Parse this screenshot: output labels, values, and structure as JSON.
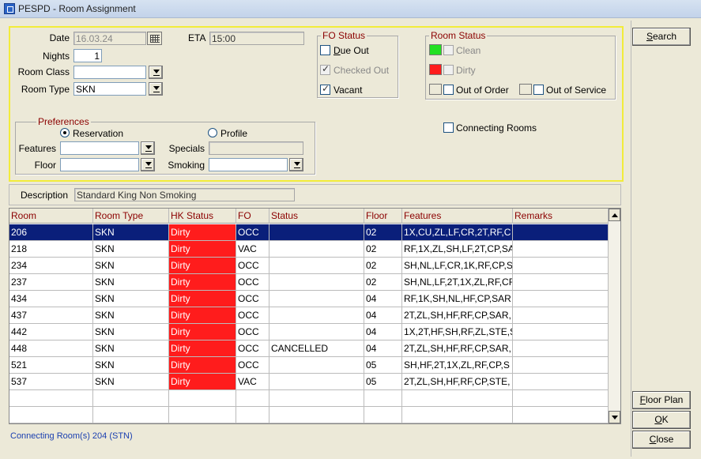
{
  "window": {
    "title": "PESPD - Room Assignment"
  },
  "filters": {
    "date_label": "Date",
    "date_value": "16.03.24",
    "eta_label": "ETA",
    "eta_value": "15:00",
    "nights_label": "Nights",
    "nights_value": "1",
    "room_class_label": "Room Class",
    "room_class_value": "",
    "room_type_label": "Room Type",
    "room_type_value": "SKN"
  },
  "fo_status": {
    "title": "FO Status",
    "due_out": {
      "label": "Due Out",
      "checked": false
    },
    "checked_out": {
      "label": "Checked Out",
      "checked": true
    },
    "vacant": {
      "label": "Vacant",
      "checked": true
    }
  },
  "room_status": {
    "title": "Room Status",
    "clean": {
      "label": "Clean",
      "color": "#22e022"
    },
    "dirty": {
      "label": "Dirty",
      "color": "#ff1c1c"
    },
    "out_of_order": {
      "label": "Out of Order"
    },
    "out_of_service": {
      "label": "Out of Service"
    }
  },
  "connecting_rooms": {
    "label": "Connecting Rooms"
  },
  "preferences": {
    "title": "Preferences",
    "reservation_label": "Reservation",
    "profile_label": "Profile",
    "features_label": "Features",
    "features_value": "",
    "specials_label": "Specials",
    "specials_value": "",
    "floor_label": "Floor",
    "floor_value": "",
    "smoking_label": "Smoking",
    "smoking_value": ""
  },
  "description": {
    "label": "Description",
    "value": "Standard King Non Smoking"
  },
  "table": {
    "columns": [
      "Room",
      "Room Type",
      "HK Status",
      "FO",
      "Status",
      "Floor",
      "Features",
      "Remarks"
    ],
    "rows": [
      {
        "room": "206",
        "type": "SKN",
        "hk": "Dirty",
        "fo": "OCC",
        "status": "",
        "floor": "02",
        "features": "1X,CU,ZL,LF,CR,2T,RF,C",
        "remarks": ""
      },
      {
        "room": "218",
        "type": "SKN",
        "hk": "Dirty",
        "fo": "VAC",
        "status": "",
        "floor": "02",
        "features": "RF,1X,ZL,SH,LF,2T,CP,SA",
        "remarks": ""
      },
      {
        "room": "234",
        "type": "SKN",
        "hk": "Dirty",
        "fo": "OCC",
        "status": "",
        "floor": "02",
        "features": "SH,NL,LF,CR,1K,RF,CP,S",
        "remarks": ""
      },
      {
        "room": "237",
        "type": "SKN",
        "hk": "Dirty",
        "fo": "OCC",
        "status": "",
        "floor": "02",
        "features": "SH,NL,LF,2T,1X,ZL,RF,CF",
        "remarks": ""
      },
      {
        "room": "434",
        "type": "SKN",
        "hk": "Dirty",
        "fo": "OCC",
        "status": "",
        "floor": "04",
        "features": "RF,1K,SH,NL,HF,CP,SAR",
        "remarks": ""
      },
      {
        "room": "437",
        "type": "SKN",
        "hk": "Dirty",
        "fo": "OCC",
        "status": "",
        "floor": "04",
        "features": "2T,ZL,SH,HF,RF,CP,SAR,",
        "remarks": ""
      },
      {
        "room": "442",
        "type": "SKN",
        "hk": "Dirty",
        "fo": "OCC",
        "status": "",
        "floor": "04",
        "features": "1X,2T,HF,SH,RF,ZL,STE,S",
        "remarks": ""
      },
      {
        "room": "448",
        "type": "SKN",
        "hk": "Dirty",
        "fo": "OCC",
        "status": "CANCELLED",
        "floor": "04",
        "features": "2T,ZL,SH,HF,RF,CP,SAR,",
        "remarks": ""
      },
      {
        "room": "521",
        "type": "SKN",
        "hk": "Dirty",
        "fo": "OCC",
        "status": "",
        "floor": "05",
        "features": "SH,HF,2T,1X,ZL,RF,CP,S",
        "remarks": ""
      },
      {
        "room": "537",
        "type": "SKN",
        "hk": "Dirty",
        "fo": "VAC",
        "status": "",
        "floor": "05",
        "features": "2T,ZL,SH,HF,RF,CP,STE,",
        "remarks": ""
      }
    ]
  },
  "footer": {
    "connecting_text": "Connecting Room(s) 204 (STN)"
  },
  "buttons": {
    "search": "Search",
    "floor_plan": "Floor Plan",
    "ok": "OK",
    "close": "Close"
  }
}
